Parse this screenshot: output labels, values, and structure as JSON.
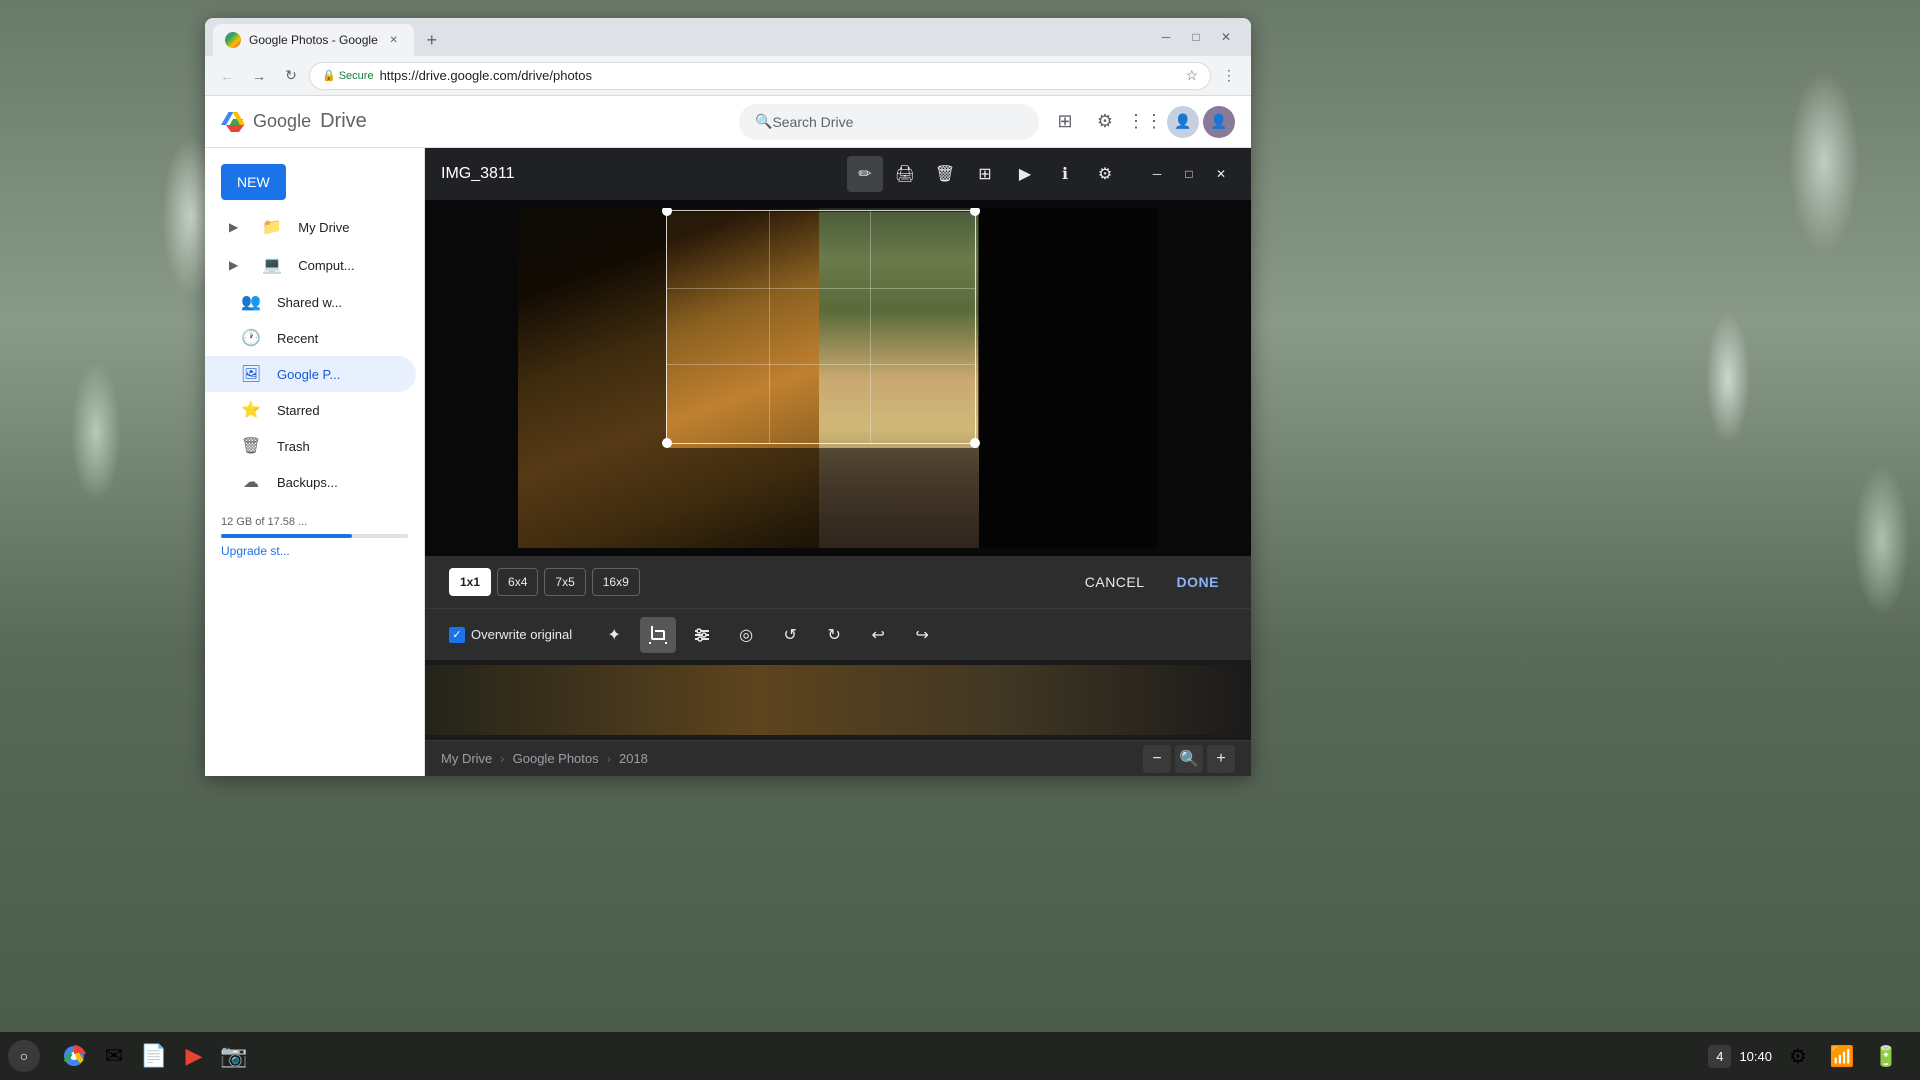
{
  "browser": {
    "tab_title": "Google Photos - Google",
    "url": "https://drive.google.com/drive/photos",
    "secure_label": "Secure"
  },
  "drive": {
    "title": "Drive",
    "google_letters": [
      "G",
      "o",
      "o",
      "g",
      "l",
      "e"
    ],
    "search_placeholder": "Search Drive",
    "new_button": "NEW",
    "sidebar_items": [
      {
        "id": "my-drive",
        "label": "My Drive",
        "icon": "📁"
      },
      {
        "id": "computers",
        "label": "Computers",
        "icon": "💻"
      },
      {
        "id": "shared-with-me",
        "label": "Shared with me",
        "icon": "👥"
      },
      {
        "id": "recent",
        "label": "Recent",
        "icon": "🕐"
      },
      {
        "id": "google-photos",
        "label": "Google Photos",
        "icon": "🖼"
      },
      {
        "id": "starred",
        "label": "Starred",
        "icon": "⭐"
      },
      {
        "id": "trash",
        "label": "Trash",
        "icon": "🗑"
      },
      {
        "id": "backups",
        "label": "Backups",
        "icon": "☁"
      }
    ],
    "storage_label": "12 GB of 17.58 ...",
    "upgrade_label": "Upgrade st..."
  },
  "modal": {
    "filename": "IMG_3811",
    "toolbar_buttons": [
      {
        "id": "edit",
        "label": "✏️",
        "active": true
      },
      {
        "id": "print",
        "label": "🖨"
      },
      {
        "id": "delete",
        "label": "🗑"
      },
      {
        "id": "grid",
        "label": "⊞"
      },
      {
        "id": "play",
        "label": "▶"
      },
      {
        "id": "info",
        "label": "ℹ"
      },
      {
        "id": "settings",
        "label": "⚙"
      }
    ],
    "win_controls": [
      {
        "id": "minimize",
        "label": "—"
      },
      {
        "id": "maximize",
        "label": "□"
      },
      {
        "id": "close",
        "label": "✕"
      }
    ]
  },
  "crop": {
    "aspect_ratios": [
      {
        "id": "1x1",
        "label": "1x1",
        "active": true
      },
      {
        "id": "6x4",
        "label": "6x4",
        "active": false
      },
      {
        "id": "7x5",
        "label": "7x5",
        "active": false
      },
      {
        "id": "16x9",
        "label": "16x9",
        "active": false
      }
    ],
    "cancel_label": "CANCEL",
    "done_label": "DONE"
  },
  "edit_tools": {
    "overwrite_label": "Overwrite original",
    "tools": [
      {
        "id": "magic",
        "icon": "✨",
        "label": "Auto enhance"
      },
      {
        "id": "crop",
        "icon": "⊡",
        "label": "Crop",
        "active": true
      },
      {
        "id": "adjust",
        "icon": "▦",
        "label": "Adjust lighting"
      },
      {
        "id": "color",
        "icon": "◎",
        "label": "Color"
      },
      {
        "id": "rotate-left",
        "icon": "↺",
        "label": "Rotate left"
      },
      {
        "id": "rotate-right",
        "icon": "↻",
        "label": "Rotate right"
      },
      {
        "id": "undo",
        "icon": "↩",
        "label": "Undo"
      },
      {
        "id": "redo",
        "icon": "↪",
        "label": "Redo"
      }
    ]
  },
  "breadcrumb": {
    "items": [
      "My Drive",
      "Google Photos",
      "2018"
    ],
    "separator": "›"
  },
  "zoom": {
    "minus": "−",
    "zoom_icon": "🔍",
    "plus": "+"
  },
  "taskbar": {
    "badge": "4",
    "time": "10:40",
    "apps": [
      {
        "id": "chrome-menu",
        "icon": "☰"
      },
      {
        "id": "chrome",
        "color": "#4285f4"
      },
      {
        "id": "gmail",
        "color": "#ea4335"
      },
      {
        "id": "docs",
        "color": "#4285f4"
      },
      {
        "id": "youtube",
        "color": "#ea4335"
      },
      {
        "id": "photos",
        "color": "#34a853"
      }
    ]
  }
}
